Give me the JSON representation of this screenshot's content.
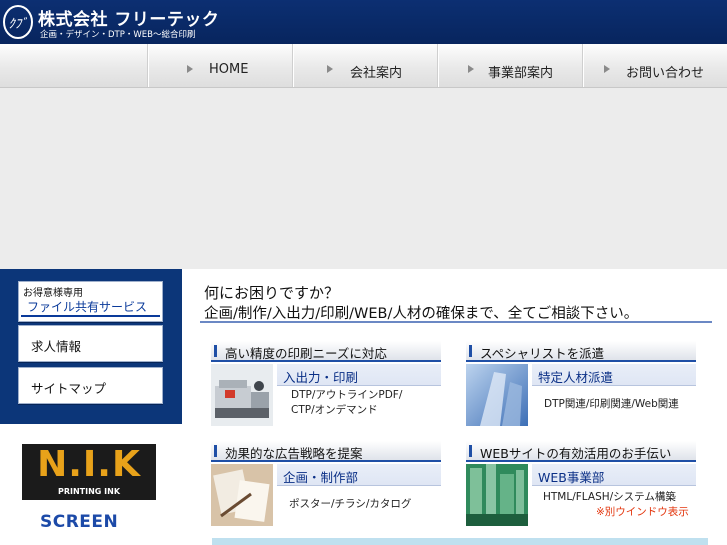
{
  "header": {
    "logo_monogram": "ｸﾌﾞ",
    "company_name": "株式会社 フリーテック",
    "tagline": "企画・デザイン・DTP・WEB〜総合印刷"
  },
  "nav": {
    "items": [
      {
        "label": "HOME"
      },
      {
        "label": "会社案内"
      },
      {
        "label": "事業部案内"
      },
      {
        "label": "お問い合わせ"
      }
    ]
  },
  "sidebar": {
    "file_share": {
      "small": "お得意様専用",
      "label": "ファイル共有サービス"
    },
    "jobs": "求人情報",
    "sitemap": "サイトマップ",
    "partner_logos": {
      "nik": "N.I.K",
      "nik_sub": "PRINTING INK",
      "screen": "SCREEN"
    }
  },
  "main": {
    "intro_question": "何にお困りですか？",
    "intro_text": "企画/制作/入出力/印刷/WEB/人材の確保まで、全てご相談下さい。",
    "cards": [
      {
        "heading": "高い精度の印刷ニーズに対応",
        "title": "入出力・印刷",
        "desc": [
          "DTP/アウトラインPDF/",
          "CTP/オンデマンド"
        ],
        "note": ""
      },
      {
        "heading": "スペシャリストを派遣",
        "title": "特定人材派遣",
        "desc": [
          "DTP関連/印刷関連/Web関連"
        ],
        "note": ""
      },
      {
        "heading": "効果的な広告戦略を提案",
        "title": "企画・制作部",
        "desc": [
          "ポスター/チラシ/カタログ"
        ],
        "note": ""
      },
      {
        "heading": "WEBサイトの有効活用のお手伝い",
        "title": "WEB事業部",
        "desc": [
          "HTML/FLASH/システム構築"
        ],
        "note": "※別ウインドウ表示"
      }
    ]
  },
  "colors": {
    "header_bg": "#0c2f72",
    "sidebar_bg": "#0c3679",
    "accent_blue": "#1f4fa6",
    "note_red": "#e3360e"
  }
}
